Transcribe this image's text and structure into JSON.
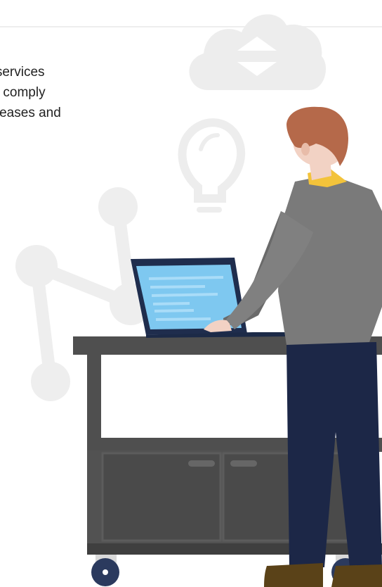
{
  "intro": {
    "lines": [
      "d services",
      "ou comply",
      "releases and"
    ]
  },
  "colors": {
    "background": "#ffffff",
    "text": "#222222",
    "decoration": "#ededed",
    "cart": "#4f4f4f",
    "cart_dark": "#3d3d3d",
    "laptop_screen": "#7ec8f0",
    "sweater": "#7a7a7a",
    "trousers": "#1c2747",
    "hair": "#b5694a",
    "skin": "#f2d2c4",
    "collar": "#f3c33b",
    "shoes": "#5a4218"
  },
  "icons": [
    "cloud-sync-icon",
    "lightbulb-icon",
    "network-graph-icon"
  ]
}
